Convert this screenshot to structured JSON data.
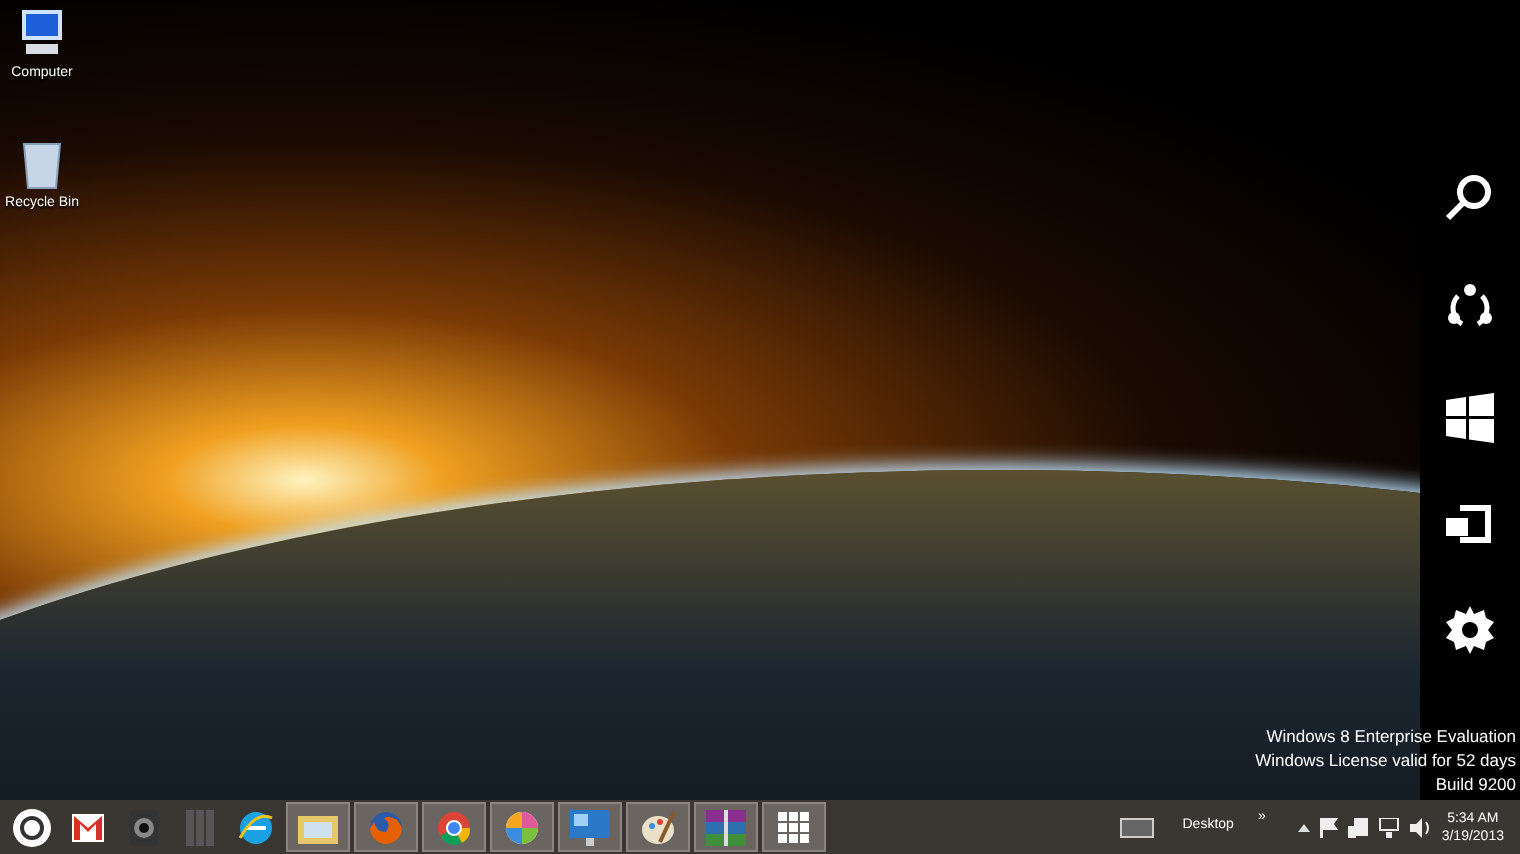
{
  "desktop_icons": [
    {
      "label": "Computer",
      "kind": "computer"
    },
    {
      "label": "Recycle Bin",
      "kind": "recycle"
    }
  ],
  "charms": [
    {
      "kind": "search"
    },
    {
      "kind": "share"
    },
    {
      "kind": "start"
    },
    {
      "kind": "devices"
    },
    {
      "kind": "settings"
    }
  ],
  "watermark": [
    "Windows 8 Enterprise Evaluation",
    "Windows License valid for 52 days",
    "Build 9200"
  ],
  "taskbar": {
    "buttons": [
      {
        "kind": "start-orb",
        "running": false
      },
      {
        "kind": "mail",
        "running": false
      },
      {
        "kind": "camera",
        "running": false
      },
      {
        "kind": "grid",
        "running": false
      },
      {
        "kind": "browser-e",
        "running": false
      },
      {
        "kind": "folder",
        "running": true
      },
      {
        "kind": "fox",
        "running": true
      },
      {
        "kind": "wheel",
        "running": true
      },
      {
        "kind": "pinwheel",
        "running": true
      },
      {
        "kind": "monitor",
        "running": true
      },
      {
        "kind": "paint",
        "running": true
      },
      {
        "kind": "books",
        "running": true
      },
      {
        "kind": "apps",
        "running": true
      }
    ],
    "toolbar_label": "Desktop",
    "toolbar_chevron": "»",
    "tray_icons": [
      {
        "kind": "expander"
      },
      {
        "kind": "flag"
      },
      {
        "kind": "devices"
      },
      {
        "kind": "network"
      },
      {
        "kind": "volume"
      }
    ],
    "time": "5:34 AM",
    "date": "3/19/2013"
  }
}
